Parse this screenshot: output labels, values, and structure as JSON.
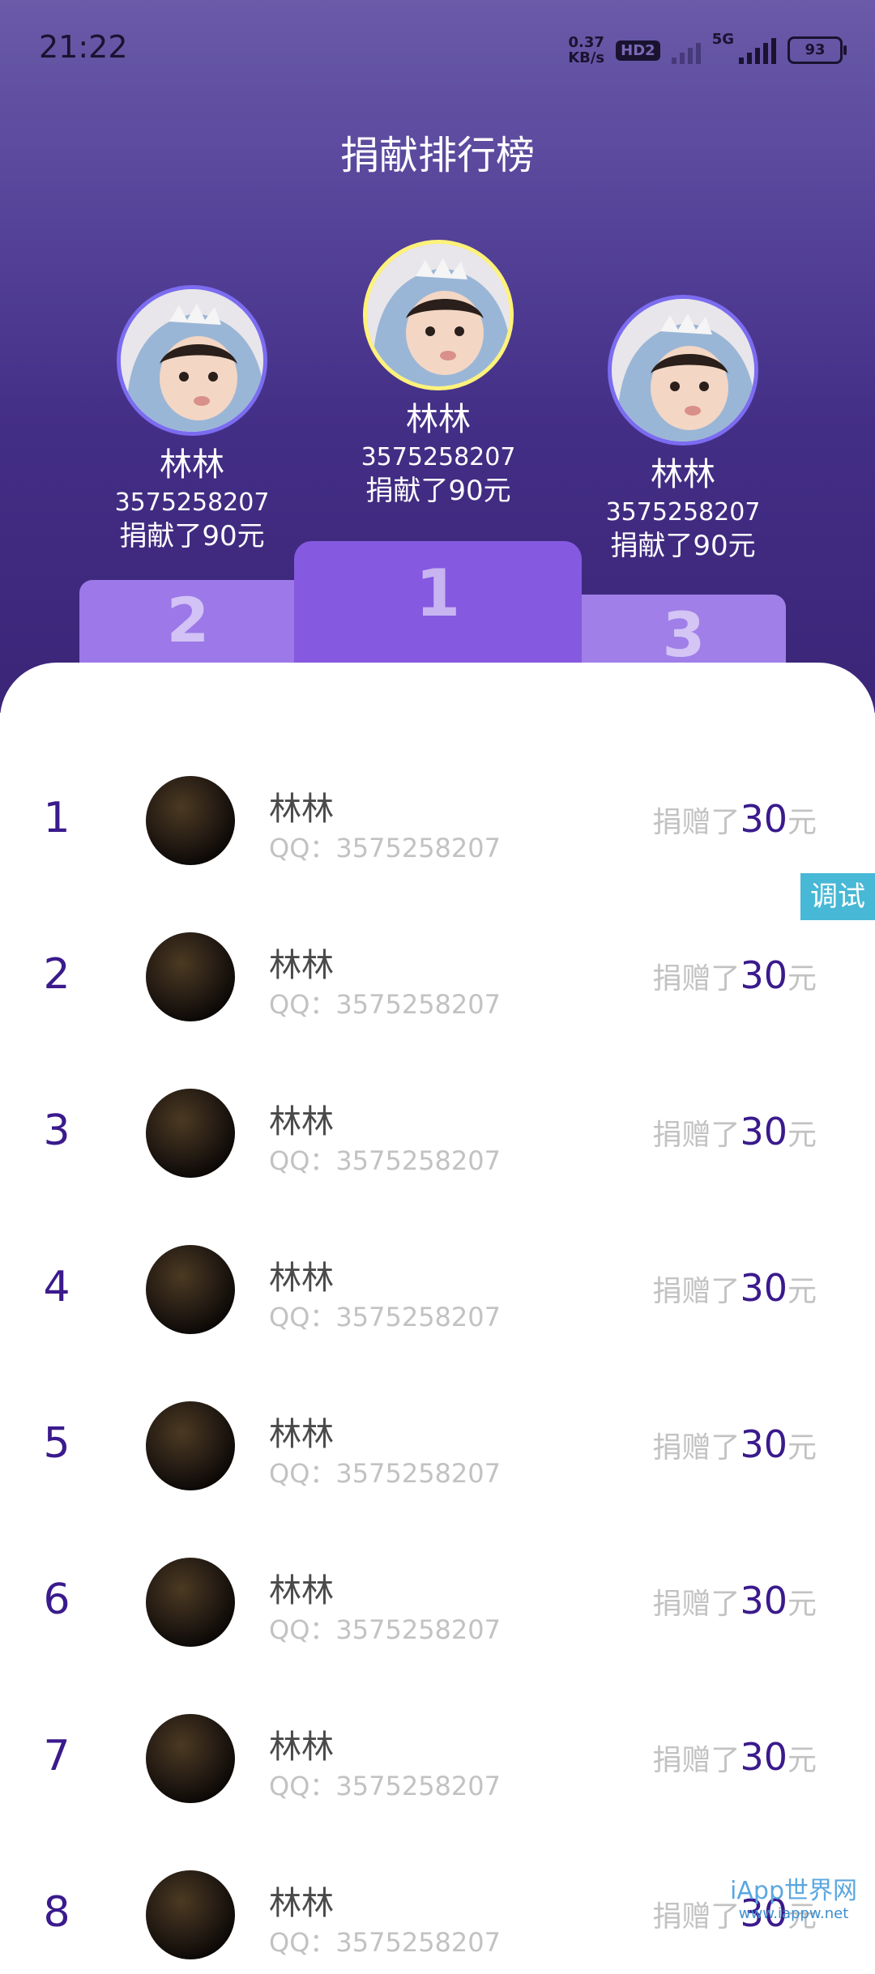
{
  "status_bar": {
    "time": "21:22",
    "net_speed_value": "0.37",
    "net_speed_unit": "KB/s",
    "hd_badge": "HD2",
    "network_type": "5G",
    "battery": "93"
  },
  "page": {
    "title": "捐献排行榜"
  },
  "podium": {
    "first": {
      "name": "林林",
      "qq": "3575258207",
      "amount": "捐献了90元",
      "place": "1"
    },
    "second": {
      "name": "林林",
      "qq": "3575258207",
      "amount": "捐献了90元",
      "place": "2"
    },
    "third": {
      "name": "林林",
      "qq": "3575258207",
      "amount": "捐献了90元",
      "place": "3"
    }
  },
  "list": {
    "rows": [
      {
        "rank": "1",
        "name": "林林",
        "qq_label": "QQ：",
        "qq": "3575258207",
        "amount_prefix": "捐赠了",
        "amount_value": "30",
        "amount_suffix": "元"
      },
      {
        "rank": "2",
        "name": "林林",
        "qq_label": "QQ：",
        "qq": "3575258207",
        "amount_prefix": "捐赠了",
        "amount_value": "30",
        "amount_suffix": "元"
      },
      {
        "rank": "3",
        "name": "林林",
        "qq_label": "QQ：",
        "qq": "3575258207",
        "amount_prefix": "捐赠了",
        "amount_value": "30",
        "amount_suffix": "元"
      },
      {
        "rank": "4",
        "name": "林林",
        "qq_label": "QQ：",
        "qq": "3575258207",
        "amount_prefix": "捐赠了",
        "amount_value": "30",
        "amount_suffix": "元"
      },
      {
        "rank": "5",
        "name": "林林",
        "qq_label": "QQ：",
        "qq": "3575258207",
        "amount_prefix": "捐赠了",
        "amount_value": "30",
        "amount_suffix": "元"
      },
      {
        "rank": "6",
        "name": "林林",
        "qq_label": "QQ：",
        "qq": "3575258207",
        "amount_prefix": "捐赠了",
        "amount_value": "30",
        "amount_suffix": "元"
      },
      {
        "rank": "7",
        "name": "林林",
        "qq_label": "QQ：",
        "qq": "3575258207",
        "amount_prefix": "捐赠了",
        "amount_value": "30",
        "amount_suffix": "元"
      },
      {
        "rank": "8",
        "name": "林林",
        "qq_label": "QQ：",
        "qq": "3575258207",
        "amount_prefix": "捐赠了",
        "amount_value": "30",
        "amount_suffix": "元"
      }
    ]
  },
  "debug_tab": {
    "label": "调试"
  },
  "watermark": {
    "title": "iApp世界网",
    "url": "www.iappw.net"
  },
  "colors": {
    "header_top": "#6a5aa8",
    "header_bottom": "#3b2578",
    "accent": "#3a1a8c",
    "gold_ring": "#fff27a",
    "ring": "#7b6cf0"
  }
}
